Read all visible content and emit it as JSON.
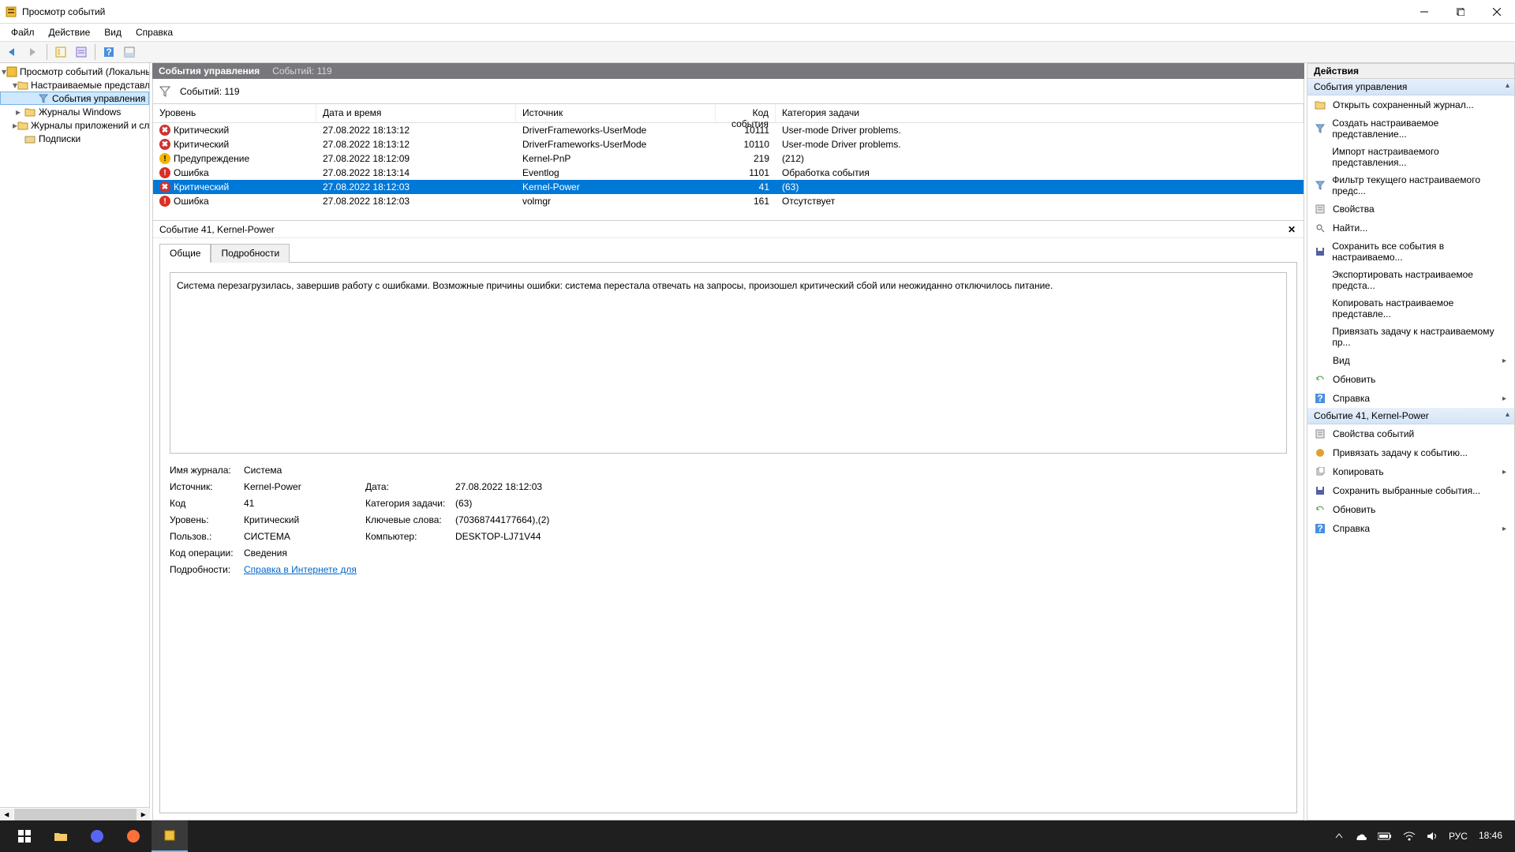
{
  "window": {
    "title": "Просмотр событий"
  },
  "menu": {
    "file": "Файл",
    "action": "Действие",
    "view": "Вид",
    "help": "Справка"
  },
  "tree": {
    "root": "Просмотр событий (Локальный)",
    "custom_views": "Настраиваемые представления",
    "admin_events": "События управления",
    "windows_logs": "Журналы Windows",
    "app_logs": "Журналы приложений и служб",
    "subscriptions": "Подписки"
  },
  "center": {
    "tab_title": "События управления",
    "count_label": "Событий: 119",
    "filter_count": "Событий: 119",
    "columns": {
      "level": "Уровень",
      "date": "Дата и время",
      "source": "Источник",
      "code": "Код события",
      "category": "Категория задачи"
    },
    "rows": [
      {
        "icon": "critical",
        "level": "Критический",
        "date": "27.08.2022 18:13:12",
        "source": "DriverFrameworks-UserMode",
        "code": "10111",
        "category": "User-mode Driver problems."
      },
      {
        "icon": "critical",
        "level": "Критический",
        "date": "27.08.2022 18:13:12",
        "source": "DriverFrameworks-UserMode",
        "code": "10110",
        "category": "User-mode Driver problems."
      },
      {
        "icon": "warn",
        "level": "Предупреждение",
        "date": "27.08.2022 18:12:09",
        "source": "Kernel-PnP",
        "code": "219",
        "category": "(212)"
      },
      {
        "icon": "error",
        "level": "Ошибка",
        "date": "27.08.2022 18:13:14",
        "source": "Eventlog",
        "code": "1101",
        "category": "Обработка события"
      },
      {
        "icon": "critical",
        "level": "Критический",
        "date": "27.08.2022 18:12:03",
        "source": "Kernel-Power",
        "code": "41",
        "category": "(63)",
        "selected": true
      },
      {
        "icon": "error",
        "level": "Ошибка",
        "date": "27.08.2022 18:12:03",
        "source": "volmgr",
        "code": "161",
        "category": "Отсутствует"
      }
    ]
  },
  "preview": {
    "title": "Событие 41, Kernel-Power",
    "tab_general": "Общие",
    "tab_details": "Подробности",
    "description": "Система перезагрузилась, завершив работу с ошибками. Возможные причины ошибки: система перестала отвечать на запросы, произошел критический сбой или неожиданно отключилось питание.",
    "meta": {
      "log_label": "Имя журнала:",
      "log": "Система",
      "source_label": "Источник:",
      "source": "Kernel-Power",
      "date_label": "Дата:",
      "date": "27.08.2022 18:12:03",
      "code_label": "Код",
      "code": "41",
      "taskcat_label": "Категория задачи:",
      "taskcat": "(63)",
      "level_label": "Уровень:",
      "level": "Критический",
      "keywords_label": "Ключевые слова:",
      "keywords": "(70368744177664),(2)",
      "user_label": "Пользов.:",
      "user": "СИСТЕМА",
      "computer_label": "Компьютер:",
      "computer": "DESKTOP-LJ71V44",
      "opcode_label": "Код операции:",
      "opcode": "Сведения",
      "details_label": "Подробности:",
      "details_link": "Справка в Интернете для "
    }
  },
  "actions": {
    "title": "Действия",
    "section1": "События управления",
    "section2": "Событие 41, Kernel-Power",
    "items1": [
      {
        "icon": "open",
        "label": "Открыть сохраненный журнал..."
      },
      {
        "icon": "filter",
        "label": "Создать настраиваемое представление..."
      },
      {
        "icon": "blank",
        "label": "Импорт настраиваемого представления..."
      },
      {
        "icon": "filter",
        "label": "Фильтр текущего настраиваемого предс..."
      },
      {
        "icon": "props",
        "label": "Свойства"
      },
      {
        "icon": "find",
        "label": "Найти..."
      },
      {
        "icon": "save",
        "label": "Сохранить все события в настраиваемо..."
      },
      {
        "icon": "blank",
        "label": "Экспортировать настраиваемое предста..."
      },
      {
        "icon": "blank",
        "label": "Копировать настраиваемое представле..."
      },
      {
        "icon": "blank",
        "label": "Привязать задачу к настраиваемому пр..."
      },
      {
        "icon": "blank",
        "label": "Вид",
        "sub": true
      },
      {
        "icon": "refresh",
        "label": "Обновить"
      },
      {
        "icon": "help",
        "label": "Справка",
        "sub": true
      }
    ],
    "items2": [
      {
        "icon": "props",
        "label": "Свойства событий"
      },
      {
        "icon": "attach",
        "label": "Привязать задачу к событию..."
      },
      {
        "icon": "copy",
        "label": "Копировать",
        "sub": true
      },
      {
        "icon": "save",
        "label": "Сохранить выбранные события..."
      },
      {
        "icon": "refresh",
        "label": "Обновить"
      },
      {
        "icon": "help",
        "label": "Справка",
        "sub": true
      }
    ]
  },
  "taskbar": {
    "lang": "РУС",
    "time": "18:46"
  }
}
